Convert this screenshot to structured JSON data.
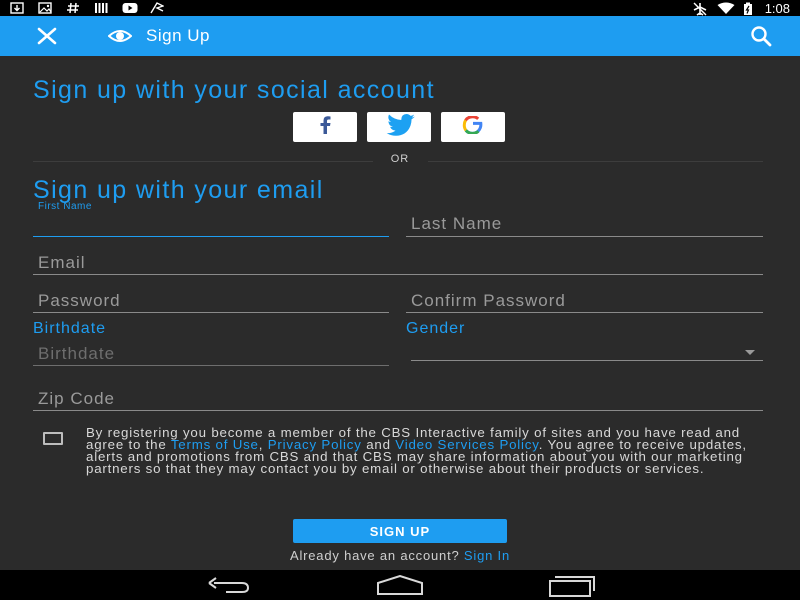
{
  "status_bar": {
    "icons_left": [
      "download-icon",
      "image-icon",
      "hash-icon",
      "bars-icon",
      "youtube-icon",
      "flag-icon"
    ],
    "icons_right": [
      "airplane-icon",
      "wifi-icon",
      "battery-icon"
    ],
    "time": "1:08"
  },
  "app_bar": {
    "close_icon": "close-icon",
    "logo_icon": "eye-icon",
    "title": "Sign Up",
    "search_icon": "search-icon",
    "color": "#1e9df1"
  },
  "social": {
    "heading": "Sign up with your social account",
    "buttons": [
      {
        "name": "facebook",
        "icon": "facebook-icon"
      },
      {
        "name": "twitter",
        "icon": "twitter-icon"
      },
      {
        "name": "google",
        "icon": "google-icon"
      }
    ],
    "divider": "OR"
  },
  "email_form": {
    "heading": "Sign up with your email",
    "first_name_label": "First Name",
    "first_name_value": "",
    "last_name_placeholder": "Last Name",
    "email_placeholder": "Email",
    "password_placeholder": "Password",
    "confirm_password_placeholder": "Confirm Password",
    "birthdate_label": "Birthdate",
    "birthdate_placeholder": "Birthdate",
    "gender_label": "Gender",
    "gender_value": "",
    "zip_placeholder": "Zip Code"
  },
  "legal": {
    "checked": false,
    "text_1": "By registering you become a member of the CBS Interactive family of sites and you have read and agree to the ",
    "terms_link": "Terms of Use",
    "comma": ", ",
    "privacy_link": "Privacy Policy",
    "text_2": " and ",
    "video_link": "Video Services Policy",
    "text_3": ". You agree to receive updates, alerts and promotions from CBS and that CBS may share information about you with our marketing partners so that they may contact you by email or otherwise about their products or services."
  },
  "actions": {
    "signup_label": "SIGN UP",
    "already_text": "Already have an account? ",
    "signin_link": "Sign In"
  },
  "nav_bar": {
    "icons": [
      "back-icon",
      "home-icon",
      "recents-icon"
    ]
  }
}
